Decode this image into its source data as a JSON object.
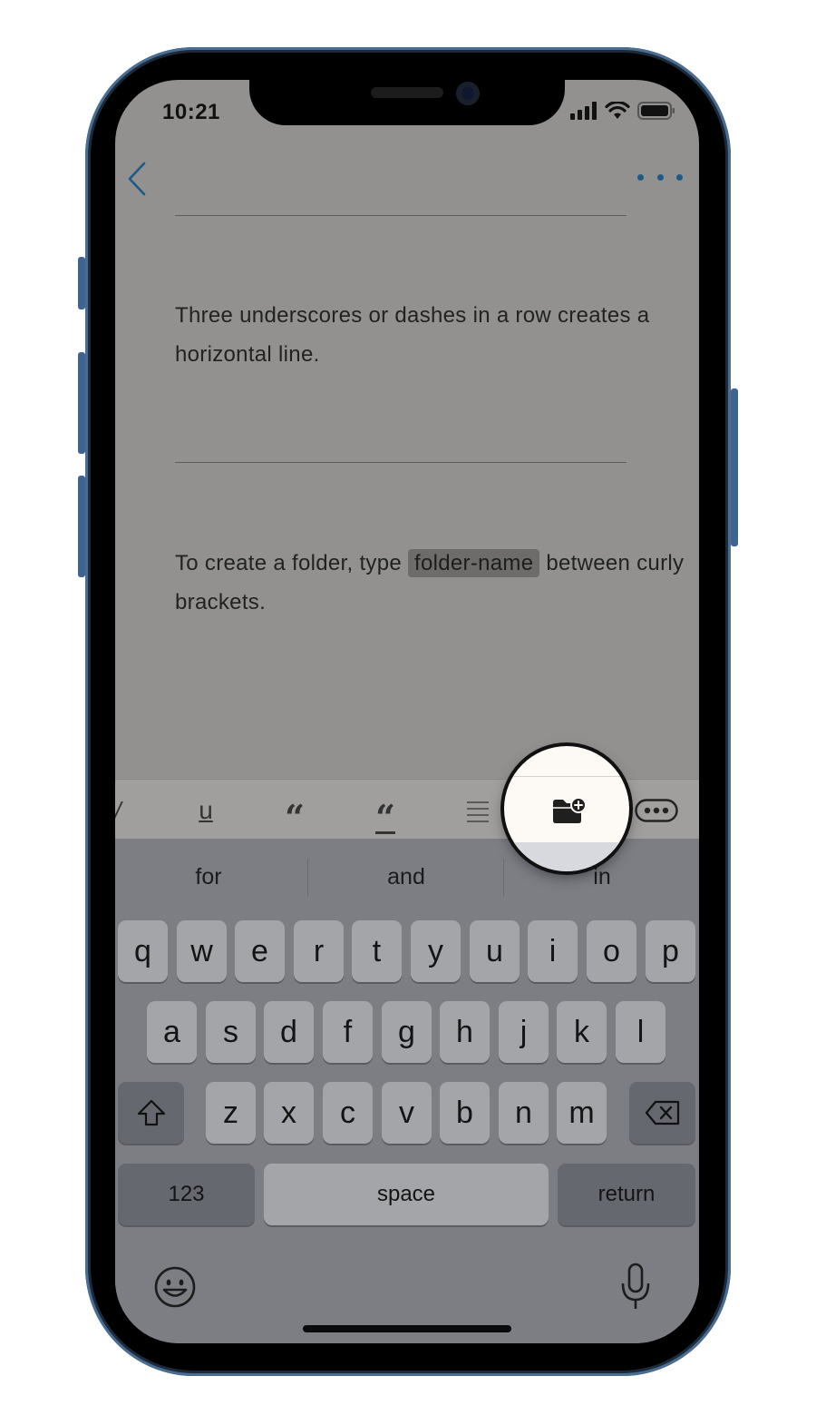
{
  "status_bar": {
    "time": "10:21"
  },
  "editor": {
    "paragraph_1": "Three underscores or dashes in a row creates a horizontal line.",
    "paragraph_2_before": "To create a folder, type ",
    "paragraph_2_code": "folder-name",
    "paragraph_2_after": " between curly brackets."
  },
  "toolbar": {
    "items": [
      "italic-icon",
      "underline-icon",
      "quote-icon",
      "block-quote-icon",
      "list-icon",
      "folder-add-icon",
      "more-icon"
    ],
    "underline_label": "u",
    "quote_label": "“",
    "block_quote_label": "“"
  },
  "keyboard": {
    "suggestions": [
      "for",
      "and",
      "in"
    ],
    "row1": [
      "q",
      "w",
      "e",
      "r",
      "t",
      "y",
      "u",
      "i",
      "o",
      "p"
    ],
    "row2": [
      "a",
      "s",
      "d",
      "f",
      "g",
      "h",
      "j",
      "k",
      "l"
    ],
    "row3": [
      "z",
      "x",
      "c",
      "v",
      "b",
      "n",
      "m"
    ],
    "numbers_label": "123",
    "space_label": "space",
    "return_label": "return"
  },
  "colors": {
    "accent": "#1d5b86",
    "dim_background": "#929190",
    "keyboard_bg": "#7c7e84"
  }
}
